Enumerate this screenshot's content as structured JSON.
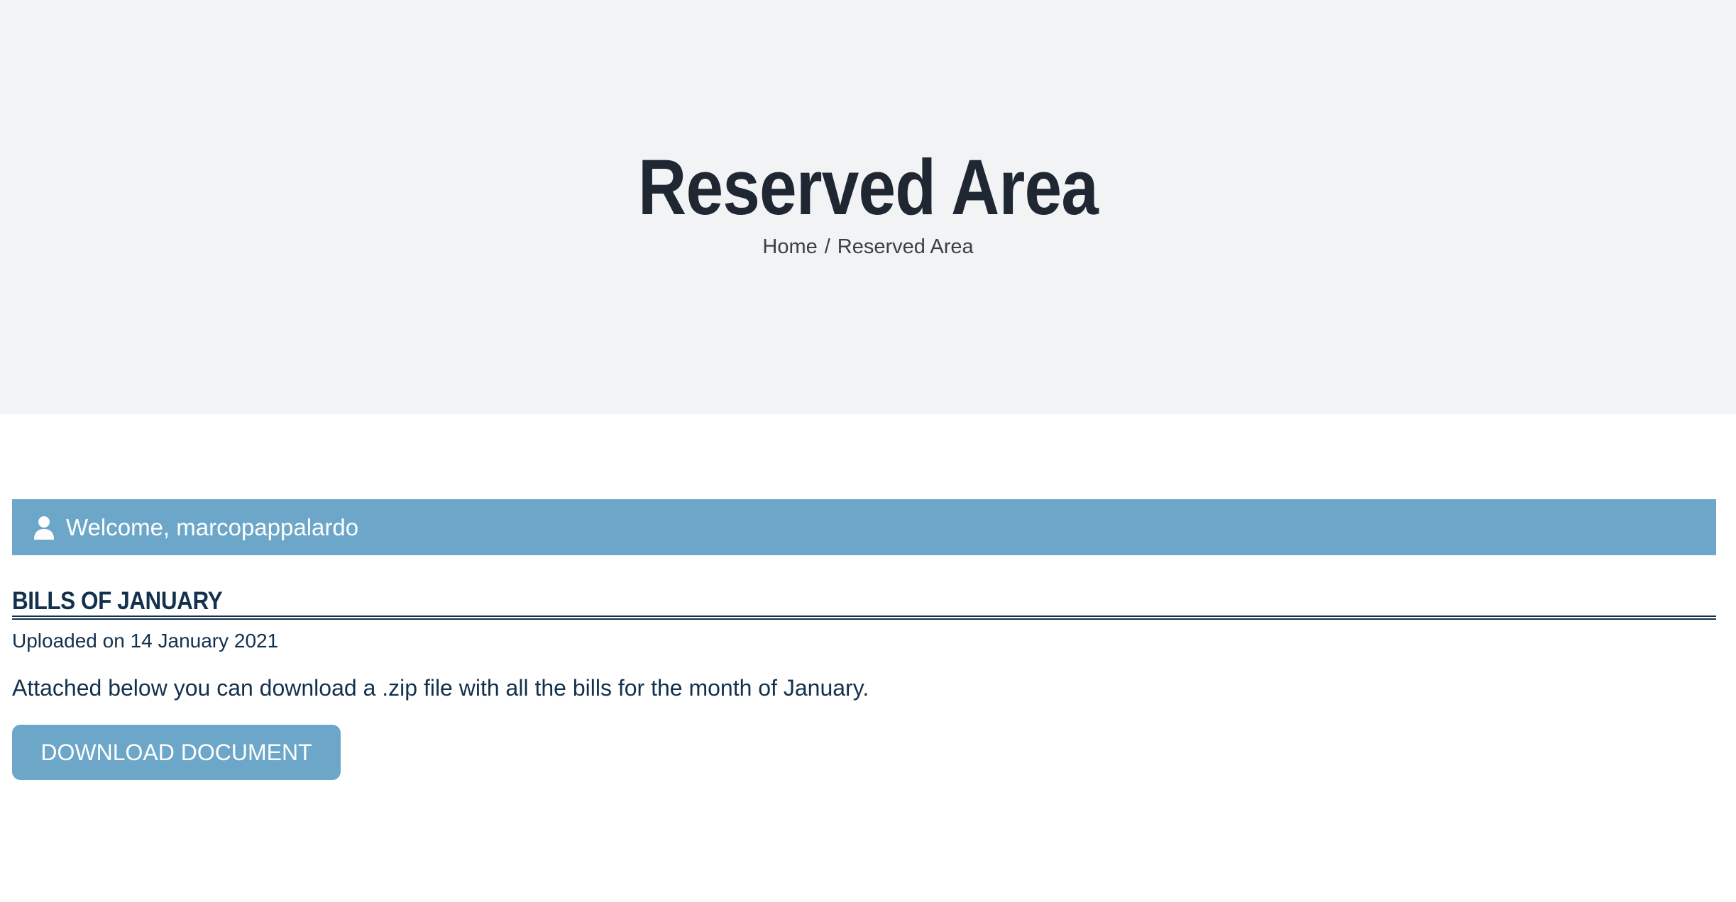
{
  "hero": {
    "title": "Reserved Area",
    "breadcrumb": {
      "home": "Home",
      "separator": "/",
      "current": "Reserved Area"
    }
  },
  "welcome": {
    "icon": "user-icon",
    "text": "Welcome, marcopappalardo"
  },
  "document": {
    "heading": "BILLS OF JANUARY",
    "uploaded": "Uploaded on 14 January 2021",
    "description": "Attached below you can download a .zip file with all the bills for the month of January.",
    "button_label": "DOWNLOAD DOCUMENT"
  },
  "colors": {
    "hero_background": "#f2f3f5",
    "accent": "#6ca6c8",
    "text_dark": "#13304d",
    "title": "#1f2733"
  }
}
